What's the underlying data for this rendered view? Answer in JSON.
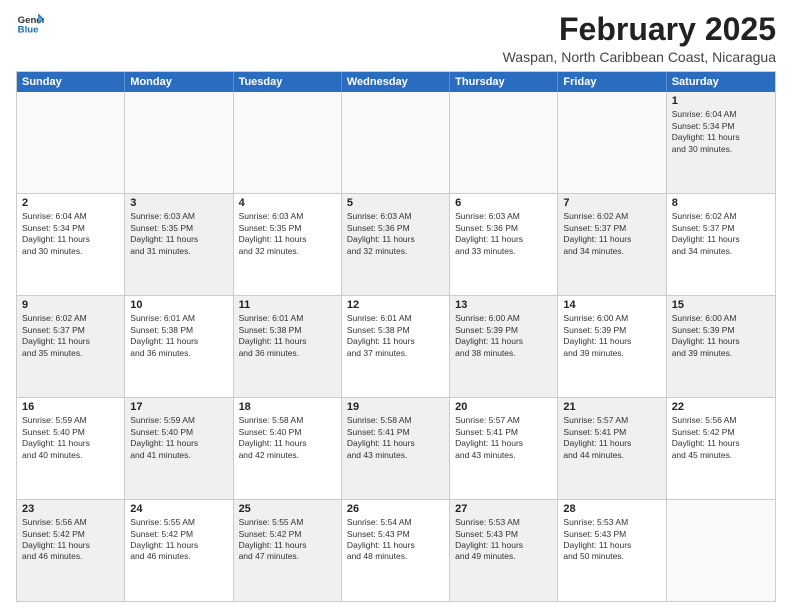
{
  "logo": {
    "line1": "General",
    "line2": "Blue"
  },
  "title": "February 2025",
  "subtitle": "Waspan, North Caribbean Coast, Nicaragua",
  "weekdays": [
    "Sunday",
    "Monday",
    "Tuesday",
    "Wednesday",
    "Thursday",
    "Friday",
    "Saturday"
  ],
  "rows": [
    [
      {
        "day": "",
        "text": "",
        "empty": true
      },
      {
        "day": "",
        "text": "",
        "empty": true
      },
      {
        "day": "",
        "text": "",
        "empty": true
      },
      {
        "day": "",
        "text": "",
        "empty": true
      },
      {
        "day": "",
        "text": "",
        "empty": true
      },
      {
        "day": "",
        "text": "",
        "empty": true
      },
      {
        "day": "1",
        "text": "Sunrise: 6:04 AM\nSunset: 5:34 PM\nDaylight: 11 hours\nand 30 minutes.",
        "shaded": true
      }
    ],
    [
      {
        "day": "2",
        "text": "Sunrise: 6:04 AM\nSunset: 5:34 PM\nDaylight: 11 hours\nand 30 minutes."
      },
      {
        "day": "3",
        "text": "Sunrise: 6:03 AM\nSunset: 5:35 PM\nDaylight: 11 hours\nand 31 minutes.",
        "shaded": true
      },
      {
        "day": "4",
        "text": "Sunrise: 6:03 AM\nSunset: 5:35 PM\nDaylight: 11 hours\nand 32 minutes."
      },
      {
        "day": "5",
        "text": "Sunrise: 6:03 AM\nSunset: 5:36 PM\nDaylight: 11 hours\nand 32 minutes.",
        "shaded": true
      },
      {
        "day": "6",
        "text": "Sunrise: 6:03 AM\nSunset: 5:36 PM\nDaylight: 11 hours\nand 33 minutes."
      },
      {
        "day": "7",
        "text": "Sunrise: 6:02 AM\nSunset: 5:37 PM\nDaylight: 11 hours\nand 34 minutes.",
        "shaded": true
      },
      {
        "day": "8",
        "text": "Sunrise: 6:02 AM\nSunset: 5:37 PM\nDaylight: 11 hours\nand 34 minutes."
      }
    ],
    [
      {
        "day": "9",
        "text": "Sunrise: 6:02 AM\nSunset: 5:37 PM\nDaylight: 11 hours\nand 35 minutes.",
        "shaded": true
      },
      {
        "day": "10",
        "text": "Sunrise: 6:01 AM\nSunset: 5:38 PM\nDaylight: 11 hours\nand 36 minutes."
      },
      {
        "day": "11",
        "text": "Sunrise: 6:01 AM\nSunset: 5:38 PM\nDaylight: 11 hours\nand 36 minutes.",
        "shaded": true
      },
      {
        "day": "12",
        "text": "Sunrise: 6:01 AM\nSunset: 5:38 PM\nDaylight: 11 hours\nand 37 minutes."
      },
      {
        "day": "13",
        "text": "Sunrise: 6:00 AM\nSunset: 5:39 PM\nDaylight: 11 hours\nand 38 minutes.",
        "shaded": true
      },
      {
        "day": "14",
        "text": "Sunrise: 6:00 AM\nSunset: 5:39 PM\nDaylight: 11 hours\nand 39 minutes."
      },
      {
        "day": "15",
        "text": "Sunrise: 6:00 AM\nSunset: 5:39 PM\nDaylight: 11 hours\nand 39 minutes.",
        "shaded": true
      }
    ],
    [
      {
        "day": "16",
        "text": "Sunrise: 5:59 AM\nSunset: 5:40 PM\nDaylight: 11 hours\nand 40 minutes."
      },
      {
        "day": "17",
        "text": "Sunrise: 5:59 AM\nSunset: 5:40 PM\nDaylight: 11 hours\nand 41 minutes.",
        "shaded": true
      },
      {
        "day": "18",
        "text": "Sunrise: 5:58 AM\nSunset: 5:40 PM\nDaylight: 11 hours\nand 42 minutes."
      },
      {
        "day": "19",
        "text": "Sunrise: 5:58 AM\nSunset: 5:41 PM\nDaylight: 11 hours\nand 43 minutes.",
        "shaded": true
      },
      {
        "day": "20",
        "text": "Sunrise: 5:57 AM\nSunset: 5:41 PM\nDaylight: 11 hours\nand 43 minutes."
      },
      {
        "day": "21",
        "text": "Sunrise: 5:57 AM\nSunset: 5:41 PM\nDaylight: 11 hours\nand 44 minutes.",
        "shaded": true
      },
      {
        "day": "22",
        "text": "Sunrise: 5:56 AM\nSunset: 5:42 PM\nDaylight: 11 hours\nand 45 minutes."
      }
    ],
    [
      {
        "day": "23",
        "text": "Sunrise: 5:56 AM\nSunset: 5:42 PM\nDaylight: 11 hours\nand 46 minutes.",
        "shaded": true
      },
      {
        "day": "24",
        "text": "Sunrise: 5:55 AM\nSunset: 5:42 PM\nDaylight: 11 hours\nand 46 minutes."
      },
      {
        "day": "25",
        "text": "Sunrise: 5:55 AM\nSunset: 5:42 PM\nDaylight: 11 hours\nand 47 minutes.",
        "shaded": true
      },
      {
        "day": "26",
        "text": "Sunrise: 5:54 AM\nSunset: 5:43 PM\nDaylight: 11 hours\nand 48 minutes."
      },
      {
        "day": "27",
        "text": "Sunrise: 5:53 AM\nSunset: 5:43 PM\nDaylight: 11 hours\nand 49 minutes.",
        "shaded": true
      },
      {
        "day": "28",
        "text": "Sunrise: 5:53 AM\nSunset: 5:43 PM\nDaylight: 11 hours\nand 50 minutes."
      },
      {
        "day": "",
        "text": "",
        "empty": true
      }
    ]
  ]
}
